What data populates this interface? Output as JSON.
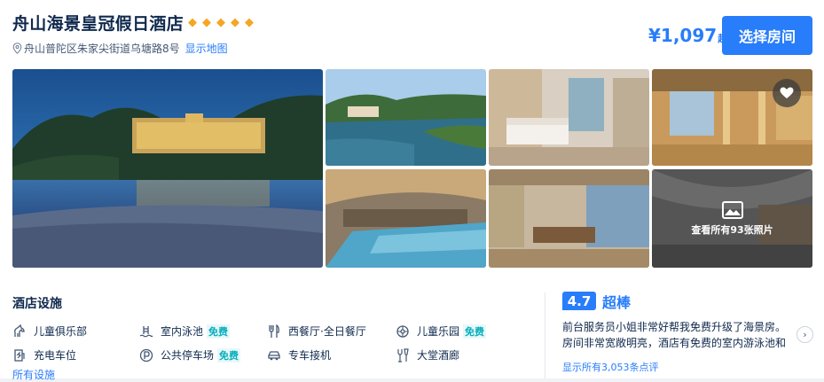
{
  "hotel": {
    "name": "舟山海景皇冠假日酒店",
    "star_rating": 5,
    "address": "舟山普陀区朱家尖街道乌塘路8号",
    "map_link": "显示地图"
  },
  "pricing": {
    "price": "¥1,097",
    "suffix": "起",
    "book_button": "选择房间"
  },
  "gallery": {
    "photos": [
      {
        "name": "photo-main-exterior-night",
        "desc": "exterior"
      },
      {
        "name": "photo-coast-view",
        "desc": "coast"
      },
      {
        "name": "photo-room",
        "desc": "room"
      },
      {
        "name": "photo-lobby",
        "desc": "lobby"
      },
      {
        "name": "photo-pool",
        "desc": "pool"
      },
      {
        "name": "photo-restaurant",
        "desc": "restaurant"
      },
      {
        "name": "photo-hall",
        "desc": "hall"
      }
    ],
    "all_photos_label": "查看所有93张照片"
  },
  "facilities": {
    "title": "酒店设施",
    "items": [
      {
        "label": "儿童俱乐部",
        "icon": "horse-icon",
        "free": ""
      },
      {
        "label": "室内泳池",
        "icon": "pool-icon",
        "free": "免费"
      },
      {
        "label": "西餐厅·全日餐厅",
        "icon": "fork-knife-icon",
        "free": ""
      },
      {
        "label": "儿童乐园",
        "icon": "playground-icon",
        "free": "免费"
      },
      {
        "label": "充电车位",
        "icon": "charging-icon",
        "free": ""
      },
      {
        "label": "公共停车场",
        "icon": "parking-icon",
        "free": "免费"
      },
      {
        "label": "专车接机",
        "icon": "car-icon",
        "free": ""
      },
      {
        "label": "大堂酒廊",
        "icon": "bar-icon",
        "free": ""
      }
    ],
    "all_link": "所有设施"
  },
  "reviews": {
    "score": "4.7",
    "label": "超棒",
    "excerpt": "前台服务员小姐非常好帮我免费升级了海景房。房间非常宽敞明亮，酒店有免费的室内游泳池和健身房...",
    "count_link": "显示所有3,053条点评"
  },
  "colors": {
    "accent": "#287dfa",
    "star": "#f5a623",
    "text": "#0f294d",
    "free_tag": "#06aebd"
  }
}
